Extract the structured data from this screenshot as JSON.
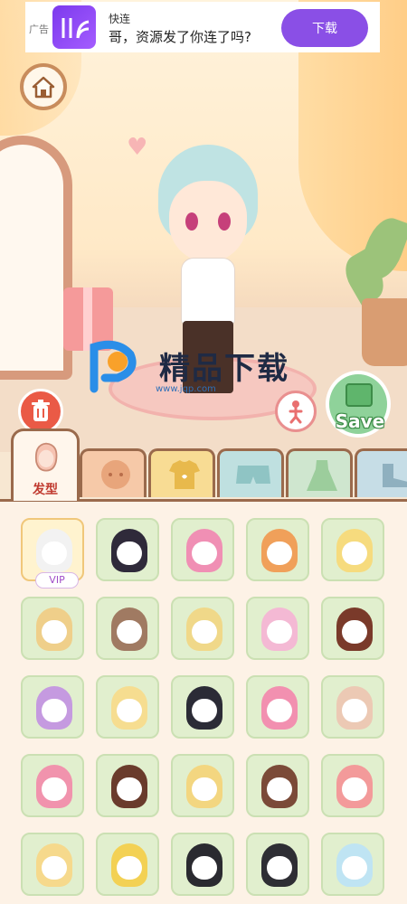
{
  "ad": {
    "tag": "广告",
    "brand": "快连",
    "text": "哥，资源发了你连了吗?",
    "button_label": "下载",
    "accent": "#8a4fe6"
  },
  "scene": {
    "home_icon": "house-icon",
    "trash_icon": "trash-icon",
    "pose_icon": "pose-icon",
    "save_label": "Save"
  },
  "watermark": {
    "title": "精品下载",
    "url": "www.jqp.com"
  },
  "tabs": [
    {
      "label": "发型",
      "icon": "hair-icon",
      "color": "#fff6ec",
      "active": true
    },
    {
      "label": "",
      "icon": "face-icon",
      "color": "#f6c9a8",
      "active": false
    },
    {
      "label": "",
      "icon": "shirt-icon",
      "color": "#f8dc94",
      "active": false
    },
    {
      "label": "",
      "icon": "pants-icon",
      "color": "#bfe0e0",
      "active": false
    },
    {
      "label": "",
      "icon": "dress-icon",
      "color": "#cfe6cf",
      "active": false
    },
    {
      "label": "",
      "icon": "shoe-icon",
      "color": "#c6dde6",
      "active": false
    }
  ],
  "hair_items": [
    {
      "color": "#f2f2f2",
      "selected": true,
      "badge": "VIP"
    },
    {
      "color": "#2f2a3a"
    },
    {
      "color": "#f08fb4"
    },
    {
      "color": "#f0a05a"
    },
    {
      "color": "#f6db7e"
    },
    {
      "color": "#efcf8a"
    },
    {
      "color": "#a07a62"
    },
    {
      "color": "#f0d889"
    },
    {
      "color": "#f4b9d4"
    },
    {
      "color": "#7a3a2a"
    },
    {
      "color": "#c59ae0"
    },
    {
      "color": "#f6dd90"
    },
    {
      "color": "#2b2b36"
    },
    {
      "color": "#f290b0"
    },
    {
      "color": "#ecc9b4"
    },
    {
      "color": "#f193ad"
    },
    {
      "color": "#6a3b2c"
    },
    {
      "color": "#f3d680"
    },
    {
      "color": "#7b4a38"
    },
    {
      "color": "#f39a9a"
    },
    {
      "color": "#f6d98c"
    },
    {
      "color": "#f3d154"
    },
    {
      "color": "#2a2a30"
    },
    {
      "color": "#2e2e34"
    },
    {
      "color": "#bfe4f3"
    }
  ]
}
